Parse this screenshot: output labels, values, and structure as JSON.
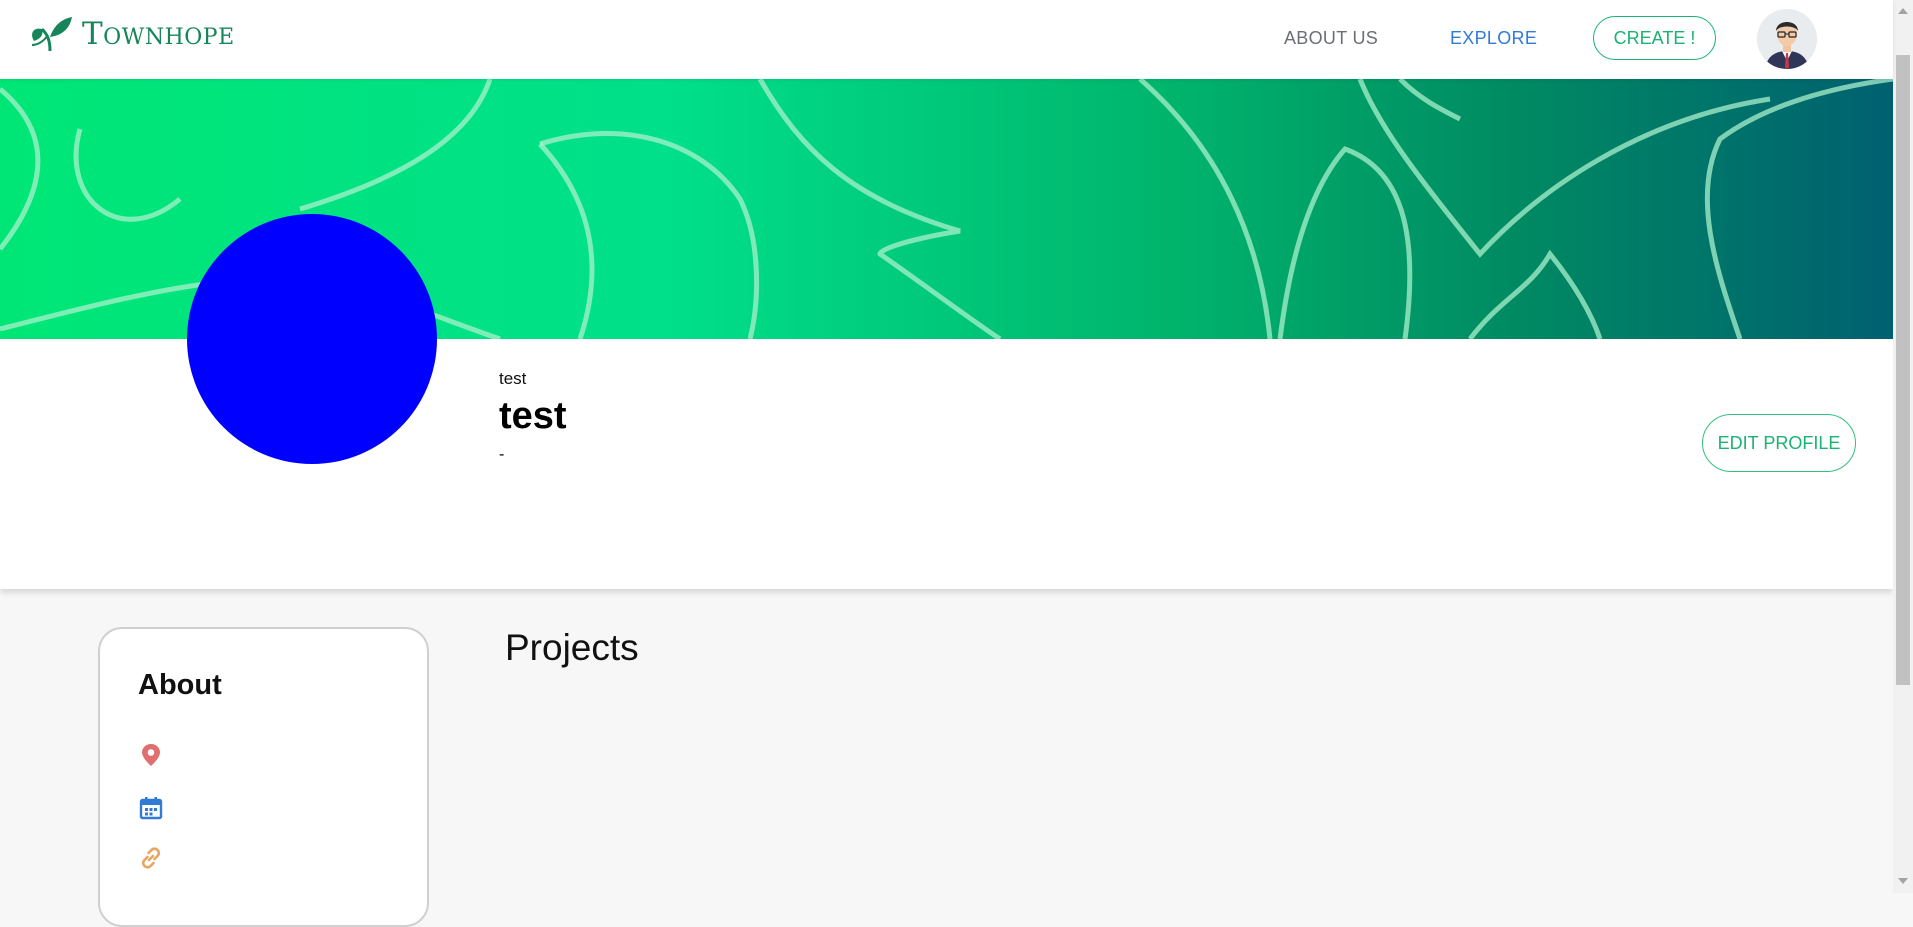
{
  "brand": {
    "name": "Townhope"
  },
  "nav": {
    "about_label": "ABOUT US",
    "explore_label": "EXPLORE",
    "create_label": "CREATE !"
  },
  "profile": {
    "username": "test",
    "display_name": "test",
    "tagline": "-",
    "edit_label": "EDIT PROFILE",
    "avatar_color": "#0000ff"
  },
  "about": {
    "title": "About",
    "items": [
      {
        "icon": "location-pin-icon",
        "text": ""
      },
      {
        "icon": "calendar-icon",
        "text": ""
      },
      {
        "icon": "link-icon",
        "text": ""
      }
    ]
  },
  "projects": {
    "title": "Projects"
  },
  "colors": {
    "brand_green": "#17855a",
    "accent_green": "#1ab372",
    "explore_blue": "#2f7bd6",
    "pin_red": "#e06f6f",
    "calendar_blue": "#2f7bd6",
    "link_orange": "#e8a560"
  }
}
